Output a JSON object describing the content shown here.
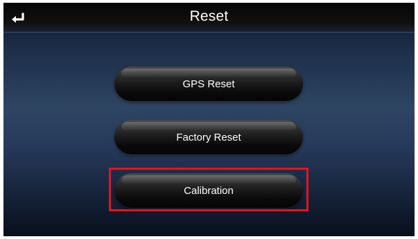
{
  "header": {
    "title": "Reset",
    "back_icon": "return-arrow-icon"
  },
  "menu": {
    "items": [
      {
        "label": "GPS Reset"
      },
      {
        "label": "Factory Reset"
      },
      {
        "label": "Calibration",
        "highlighted": true
      }
    ]
  },
  "colors": {
    "highlight": "#e8121c",
    "background_top": "#0c1628",
    "background_mid": "#2e4563",
    "button": "#1b1b1b",
    "text": "#ffffff"
  }
}
